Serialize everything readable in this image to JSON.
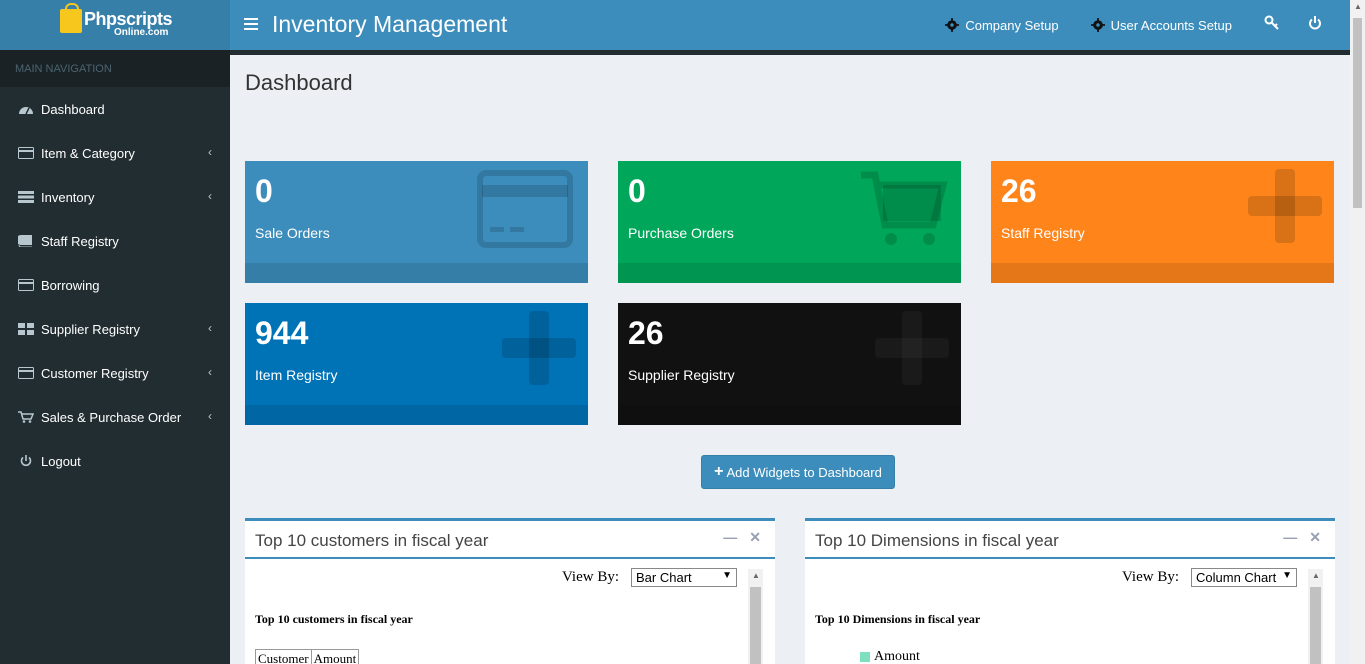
{
  "header": {
    "logo_text": "Phpscripts",
    "logo_sub": "Online.com",
    "title": "Inventory Management",
    "links": [
      "Company Setup",
      "User Accounts Setup"
    ]
  },
  "sidebar": {
    "header": "MAIN NAVIGATION",
    "items": [
      {
        "label": "Dashboard",
        "icon": "dashboard-icon",
        "chevron": false
      },
      {
        "label": "Item & Category",
        "icon": "credit-card-icon",
        "chevron": true
      },
      {
        "label": "Inventory",
        "icon": "tasks-icon",
        "chevron": true
      },
      {
        "label": "Staff Registry",
        "icon": "book-icon",
        "chevron": false
      },
      {
        "label": "Borrowing",
        "icon": "credit-card-icon",
        "chevron": false
      },
      {
        "label": "Supplier Registry",
        "icon": "grid-icon",
        "chevron": true
      },
      {
        "label": "Customer Registry",
        "icon": "credit-card-icon",
        "chevron": true
      },
      {
        "label": "Sales & Purchase Order",
        "icon": "cart-icon",
        "chevron": true
      },
      {
        "label": "Logout",
        "icon": "power-icon",
        "chevron": false
      }
    ]
  },
  "page": {
    "title": "Dashboard"
  },
  "stats": [
    {
      "value": "0",
      "label": "Sale Orders",
      "icon": "credit-card-icon",
      "color": "#3c8dbc"
    },
    {
      "value": "0",
      "label": "Purchase Orders",
      "icon": "cart-icon",
      "color": "#00a65a"
    },
    {
      "value": "26",
      "label": "Staff Registry",
      "icon": "plus-icon",
      "color": "#ff851b"
    },
    {
      "value": "944",
      "label": "Item Registry",
      "icon": "plus-icon",
      "color": "#0073b7"
    },
    {
      "value": "26",
      "label": "Supplier Registry",
      "icon": "plus-icon",
      "color": "#111111"
    }
  ],
  "add_widgets_label": "Add Widgets to Dashboard",
  "panels": [
    {
      "title": "Top 10 customers in fiscal year",
      "view_by_label": "View By:",
      "selected": "Bar Chart",
      "chart_title": "Top 10 customers in fiscal year",
      "table_headers": [
        "Customer",
        "Amount"
      ]
    },
    {
      "title": "Top 10 Dimensions in fiscal year",
      "view_by_label": "View By:",
      "selected": "Column Chart",
      "chart_title": "Top 10 Dimensions in fiscal year",
      "legend": "Amount"
    }
  ],
  "colors": {
    "header": "#3c8dbc",
    "sidebar": "#222d32",
    "background": "#ecf0f5"
  }
}
